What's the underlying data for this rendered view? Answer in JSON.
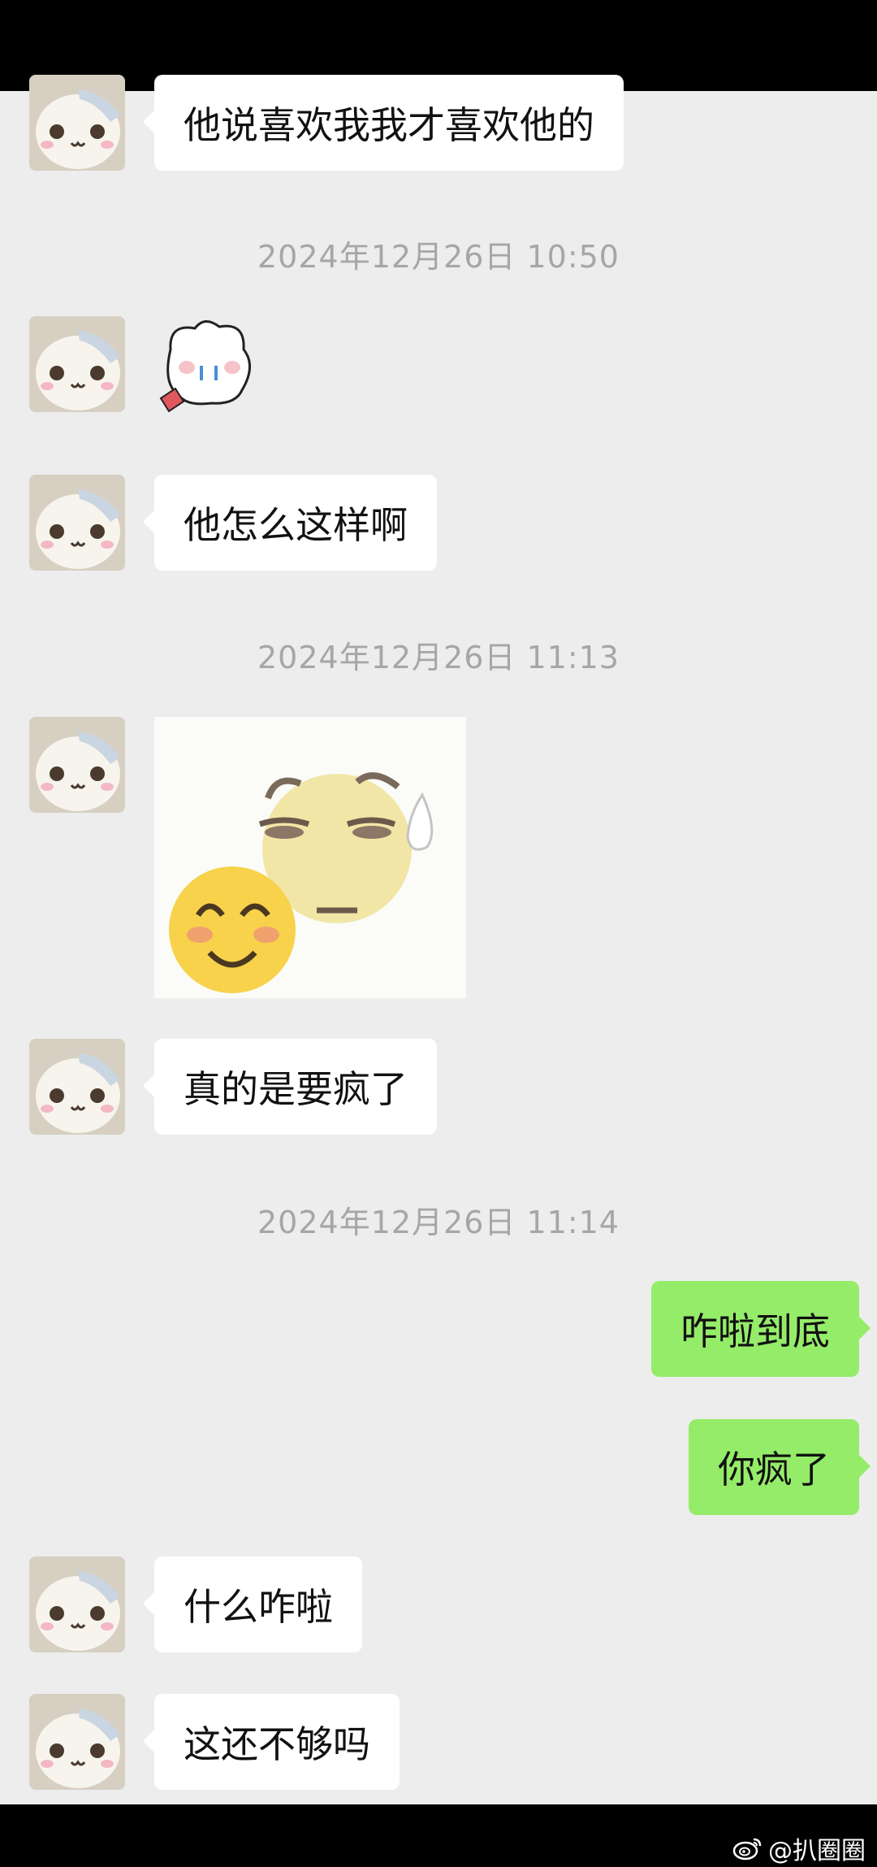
{
  "messages": {
    "m1": "他说喜欢我我才喜欢他的",
    "m3": "他怎么这样啊",
    "m5": "真的是要疯了",
    "m6": "咋啦到底",
    "m7": "你疯了",
    "m8": "什么咋啦",
    "m9": "这还不够吗"
  },
  "timestamps": {
    "t1": "2024年12月26日 10:50",
    "t2": "2024年12月26日 11:13",
    "t3": "2024年12月26日 11:14"
  },
  "watermark": {
    "icon": "weibo-icon",
    "text": "@扒圈圈"
  },
  "colors": {
    "background": "#ededed",
    "incoming_bubble": "#ffffff",
    "outgoing_bubble": "#95ec69",
    "timestamp_text": "#a6a6a6"
  }
}
